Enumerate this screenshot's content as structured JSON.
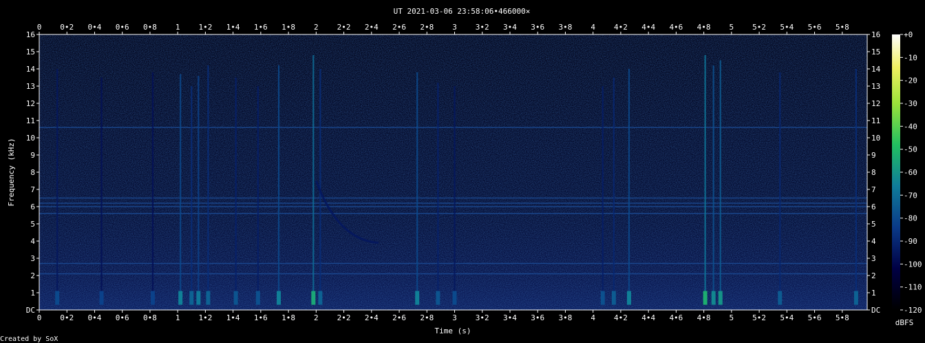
{
  "chart_data": {
    "type": "heatmap",
    "title": "UT 2021-03-06 23:58:06•466000×",
    "xlabel": "Time (s)",
    "ylabel": "Frequency (kHz)",
    "xlim": [
      0,
      5.98
    ],
    "ylim": [
      0,
      16
    ],
    "x_ticks": [
      "0",
      "0•2",
      "0•4",
      "0•6",
      "0•8",
      "1",
      "1•2",
      "1•4",
      "1•6",
      "1•8",
      "2",
      "2•2",
      "2•4",
      "2•6",
      "2•8",
      "3",
      "3•2",
      "3•4",
      "3•6",
      "3•8",
      "4",
      "4•2",
      "4•4",
      "4•6",
      "4•8",
      "5",
      "5•2",
      "5•4",
      "5•6",
      "5•8"
    ],
    "x_tick_values": [
      0,
      0.2,
      0.4,
      0.6,
      0.8,
      1,
      1.2,
      1.4,
      1.6,
      1.8,
      2,
      2.2,
      2.4,
      2.6,
      2.8,
      3,
      3.2,
      3.4,
      3.6,
      3.8,
      4,
      4.2,
      4.4,
      4.6,
      4.8,
      5,
      5.2,
      5.4,
      5.6,
      5.8
    ],
    "y_ticks": [
      "DC",
      "1",
      "2",
      "3",
      "4",
      "5",
      "6",
      "7",
      "8",
      "9",
      "10",
      "11",
      "12",
      "13",
      "14",
      "15",
      "16"
    ],
    "y_tick_values": [
      0,
      1,
      2,
      3,
      4,
      5,
      6,
      7,
      8,
      9,
      10,
      11,
      12,
      13,
      14,
      15,
      16
    ],
    "colorbar": {
      "unit": "dBFS",
      "ticks": [
        "+0",
        "-10",
        "-20",
        "-30",
        "-40",
        "-50",
        "-60",
        "-70",
        "-80",
        "-90",
        "-100",
        "-110",
        "-120"
      ],
      "tick_values": [
        0,
        -10,
        -20,
        -30,
        -40,
        -50,
        -60,
        -70,
        -80,
        -90,
        -100,
        -110,
        -120
      ],
      "range": [
        -120,
        0
      ]
    },
    "horizontal_lines_khz": [
      10.6,
      6.5,
      6.2,
      6.0,
      5.6,
      2.7,
      2.1
    ],
    "impulses": [
      {
        "t": 0.13,
        "fmax": 14.0,
        "level": -95
      },
      {
        "t": 0.45,
        "fmax": 13.5,
        "level": -97
      },
      {
        "t": 0.82,
        "fmax": 13.8,
        "level": -97
      },
      {
        "t": 1.02,
        "fmax": 13.7,
        "level": -80
      },
      {
        "t": 1.1,
        "fmax": 13.0,
        "level": -88
      },
      {
        "t": 1.15,
        "fmax": 13.6,
        "level": -82
      },
      {
        "t": 1.22,
        "fmax": 14.2,
        "level": -88
      },
      {
        "t": 1.42,
        "fmax": 13.5,
        "level": -92
      },
      {
        "t": 1.58,
        "fmax": 13.0,
        "level": -93
      },
      {
        "t": 1.73,
        "fmax": 14.2,
        "level": -80
      },
      {
        "t": 1.98,
        "fmax": 14.8,
        "level": -70
      },
      {
        "t": 2.03,
        "fmax": 14.0,
        "level": -88
      },
      {
        "t": 2.73,
        "fmax": 13.8,
        "level": -80
      },
      {
        "t": 2.88,
        "fmax": 13.2,
        "level": -92
      },
      {
        "t": 3.0,
        "fmax": 13.0,
        "level": -95
      },
      {
        "t": 4.07,
        "fmax": 13.0,
        "level": -93
      },
      {
        "t": 4.15,
        "fmax": 13.5,
        "level": -90
      },
      {
        "t": 4.26,
        "fmax": 14.0,
        "level": -80
      },
      {
        "t": 4.81,
        "fmax": 14.8,
        "level": -68
      },
      {
        "t": 4.87,
        "fmax": 14.2,
        "level": -78
      },
      {
        "t": 4.92,
        "fmax": 14.5,
        "level": -75
      },
      {
        "t": 5.35,
        "fmax": 13.8,
        "level": -90
      },
      {
        "t": 5.9,
        "fmax": 14.0,
        "level": -88
      }
    ],
    "chirp": {
      "t_start": 2.0,
      "f_start": 7.5,
      "t_end": 2.45,
      "f_end": 3.9,
      "level": -95
    }
  },
  "footer": {
    "credit": "Created by SoX"
  }
}
